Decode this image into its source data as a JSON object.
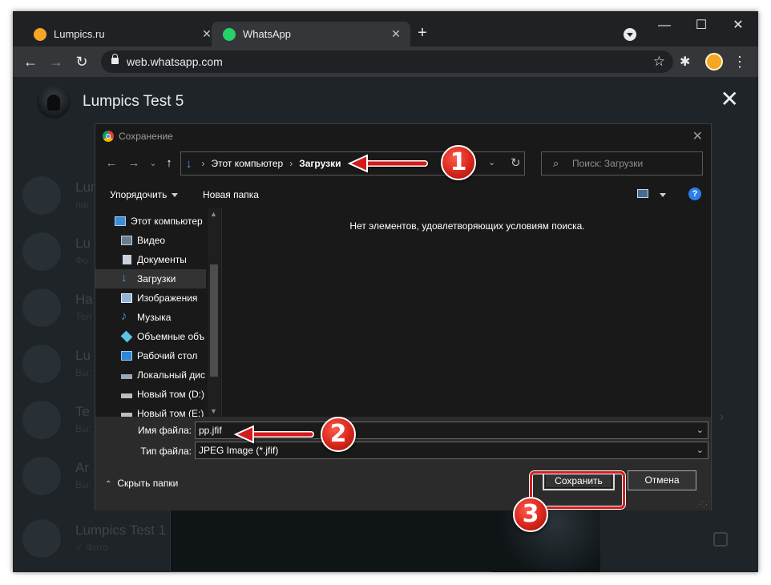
{
  "browser": {
    "tabs": [
      {
        "title": "Lumpics.ru",
        "active": false,
        "favicon_color": "#f5a623"
      },
      {
        "title": "WhatsApp",
        "active": true,
        "favicon_color": "#25d366"
      }
    ],
    "tab_close_glyph": "✕",
    "new_tab_glyph": "+",
    "window_controls": {
      "minimize": "—",
      "maximize": "☐",
      "close": "✕"
    },
    "nav": {
      "back": "←",
      "forward": "→",
      "reload": "↻"
    },
    "url": "web.whatsapp.com",
    "star_glyph": "☆",
    "extensions_glyph": "✱",
    "menu_glyph": "⋮"
  },
  "whatsapp": {
    "contact_name": "Lumpics Test 5",
    "close_glyph": "✕",
    "background_chats": [
      {
        "name": "Lum",
        "sub": "пш"
      },
      {
        "name": "Lu",
        "sub": "Фо"
      },
      {
        "name": "На",
        "sub": "Тел"
      },
      {
        "name": "Lu",
        "sub": "Вы:"
      },
      {
        "name": "Te",
        "sub": "Вы:"
      },
      {
        "name": "Ar",
        "sub": "Вы:"
      },
      {
        "name": "Lumpics Test 1",
        "sub": "✓ Фото"
      }
    ]
  },
  "dialog": {
    "title": "Сохранение",
    "close_glyph": "✕",
    "nav": {
      "back": "←",
      "forward": "→",
      "recent": "⌄",
      "up": "↑"
    },
    "breadcrumb": [
      "Этот компьютер",
      "Загрузки"
    ],
    "breadcrumb_sep": "›",
    "refresh_glyph": "↻",
    "dropdown_glyph": "⌄",
    "search_placeholder": "Поиск: Загрузки",
    "search_glyph": "⌕",
    "organize": "Упорядочить",
    "new_folder": "Новая папка",
    "help_glyph": "?",
    "nav_pane": [
      {
        "label": "Этот компьютер",
        "icon": "computer-icon",
        "color": "#3b8fd8",
        "level": 0,
        "selected": false
      },
      {
        "label": "Видео",
        "icon": "video-folder-icon",
        "color": "#6b7c8c",
        "level": 1,
        "selected": false
      },
      {
        "label": "Документы",
        "icon": "documents-folder-icon",
        "color": "#c9d2dc",
        "level": 1,
        "selected": false
      },
      {
        "label": "Загрузки",
        "icon": "downloads-folder-icon",
        "color": "#4aa0f0",
        "level": 1,
        "selected": true
      },
      {
        "label": "Изображения",
        "icon": "pictures-folder-icon",
        "color": "#8fb6d8",
        "level": 1,
        "selected": false
      },
      {
        "label": "Музыка",
        "icon": "music-folder-icon",
        "color": "#3f8fe0",
        "level": 1,
        "selected": false
      },
      {
        "label": "Объемные объ",
        "icon": "3d-objects-icon",
        "color": "#5fc3e8",
        "level": 1,
        "selected": false
      },
      {
        "label": "Рабочий стол",
        "icon": "desktop-icon",
        "color": "#2f86d6",
        "level": 1,
        "selected": false
      },
      {
        "label": "Локальный дис",
        "icon": "local-disk-icon",
        "color": "#9aa7b3",
        "level": 1,
        "selected": false
      },
      {
        "label": "Новый том (D:)",
        "icon": "drive-icon",
        "color": "#b8bec4",
        "level": 1,
        "selected": false
      },
      {
        "label": "Новый том (E:)",
        "icon": "drive-icon",
        "color": "#b8bec4",
        "level": 1,
        "selected": false
      }
    ],
    "empty_message": "Нет элементов, удовлетворяющих условиям поиска.",
    "filename_label": "Имя файла:",
    "filename_value": "pp.jfif",
    "filetype_label": "Тип файла:",
    "filetype_value": "JPEG Image (*.jfif)",
    "hide_folders": "Скрыть папки",
    "save_button": "Сохранить",
    "cancel_button": "Отмена"
  },
  "annotations": {
    "step1": "1",
    "step2": "2",
    "step3": "3",
    "color": "#d21f1f"
  }
}
